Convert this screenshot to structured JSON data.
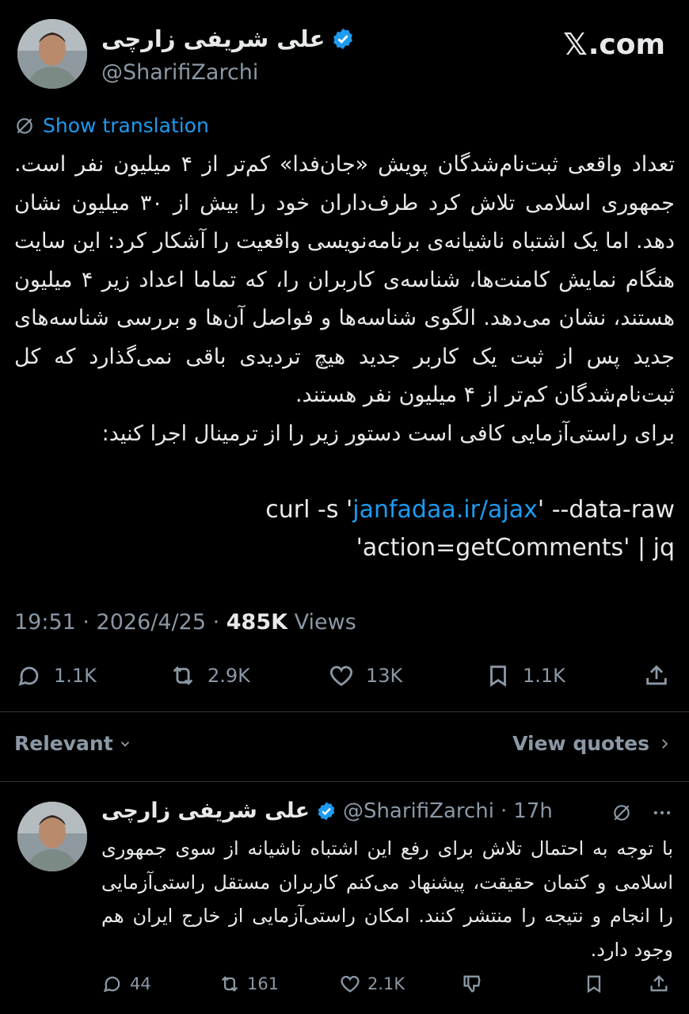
{
  "colors": {
    "background": "#000000",
    "text": "#e7e9ea",
    "muted": "#8b98a5",
    "link": "#1d9bf0",
    "verified": "#1d9bf0"
  },
  "header": {
    "display_name": "علی شریفی زارچی",
    "handle": "@SharifiZarchi",
    "site": ".com",
    "site_logo": "𝕏"
  },
  "translate": {
    "label": "Show translation",
    "icon": "globe-slash-icon"
  },
  "tweet": {
    "text": "تعداد واقعی ثبت‌نام‌شدگان پویش «جان‌فدا» کم‌تر از ۴ میلیون نفر است. جمهوری اسلامی تلاش کرد طرف‌داران خود را بیش از ۳۰ میلیون نشان دهد. اما یک اشتباه ناشیانه‌ی برنامه‌نویسی واقعیت را آشکار کرد: این سایت هنگام نمایش کامنت‌ها، شناسه‌ی کاربران را، که تماما اعداد زیر ۴ میلیون هستند، نشان می‌دهد. الگوی شناسه‌ها و فواصل آن‌ها و بررسی شناسه‌های جدید پس از ثبت یک کاربر جدید هیچ تردیدی باقی نمی‌گذارد که کل ثبت‌نام‌شدگان کم‌تر از ۴ میلیون نفر هستند.\nبرای راستی‌آزمایی کافی است دستور زیر را از ترمینال اجرا کنید:",
    "code_prefix": "curl -s '",
    "code_link": "janfadaa.ir/ajax",
    "code_mid": "' --data-raw",
    "code_line2": "'action=getComments' | jq",
    "time": "19:51 · 2026/4/25 · ",
    "views_count": "485K",
    "views_label": " Views",
    "actions": {
      "replies": "1.1K",
      "retweets": "2.9K",
      "likes": "13K",
      "bookmarks": "1.1K"
    }
  },
  "sort": {
    "relevant": "Relevant",
    "view_quotes": "View quotes"
  },
  "reply": {
    "display_name": "علی شریفی زارچی",
    "handle": "@SharifiZarchi",
    "age": "17h",
    "text": "با توجه به احتمال تلاش برای رفع این اشتباه ناشیانه از سوی جمهوری اسلامی و کتمان حقیقت، پیشنهاد می‌کنم کاربران مستقل راستی‌آزمایی را انجام و نتیجه را منتشر کنند. امکان راستی‌آزمایی از خارج ایران هم وجود دارد.",
    "actions": {
      "replies": "44",
      "retweets": "161",
      "likes": "2.1K"
    }
  }
}
